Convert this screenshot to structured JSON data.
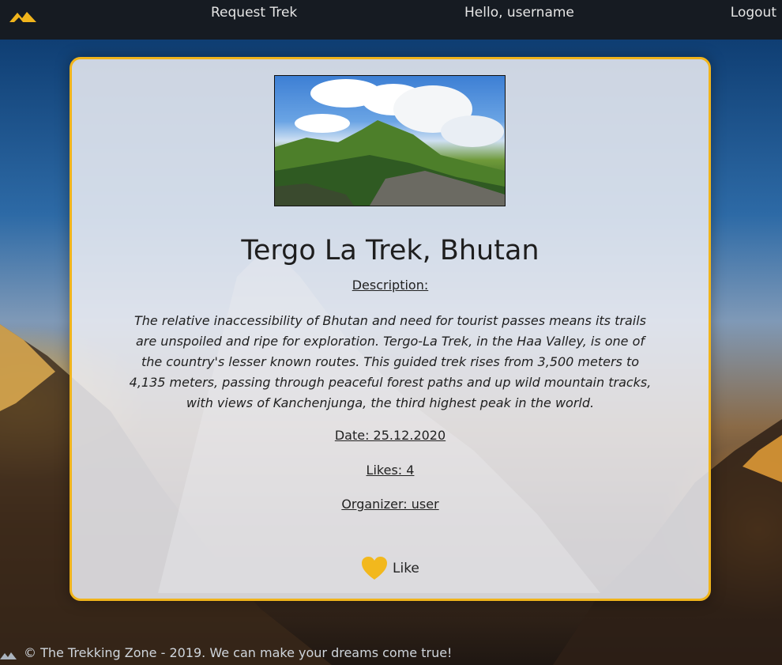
{
  "nav": {
    "logo_icon": "mountain-logo-icon",
    "request_trek": "Request Trek",
    "greeting": "Hello, username",
    "logout": "Logout"
  },
  "trek": {
    "image_alt": "mountain-landscape",
    "title": "Tergo La Trek, Bhutan",
    "description_heading": "Description:",
    "description": "The relative inaccessibility of Bhutan and need for tourist passes means its trails are unspoiled and ripe for exploration. Tergo-La Trek, in the Haa Valley, is one of the country's lesser known routes. This guided trek rises from 3,500 meters to 4,135 meters, passing through peaceful forest paths and up wild mountain tracks, with views of Kanchenjunga, the third highest peak in the world.",
    "date": "Date: 25.12.2020",
    "likes": "Likes: 4",
    "organizer": "Organizer: user",
    "like_button": "Like",
    "like_icon": "heart-icon"
  },
  "footer": {
    "text": "© The Trekking Zone - 2019. We can make your dreams come true!"
  },
  "colors": {
    "accent": "#f0b41c",
    "navbar": "#161b22"
  }
}
